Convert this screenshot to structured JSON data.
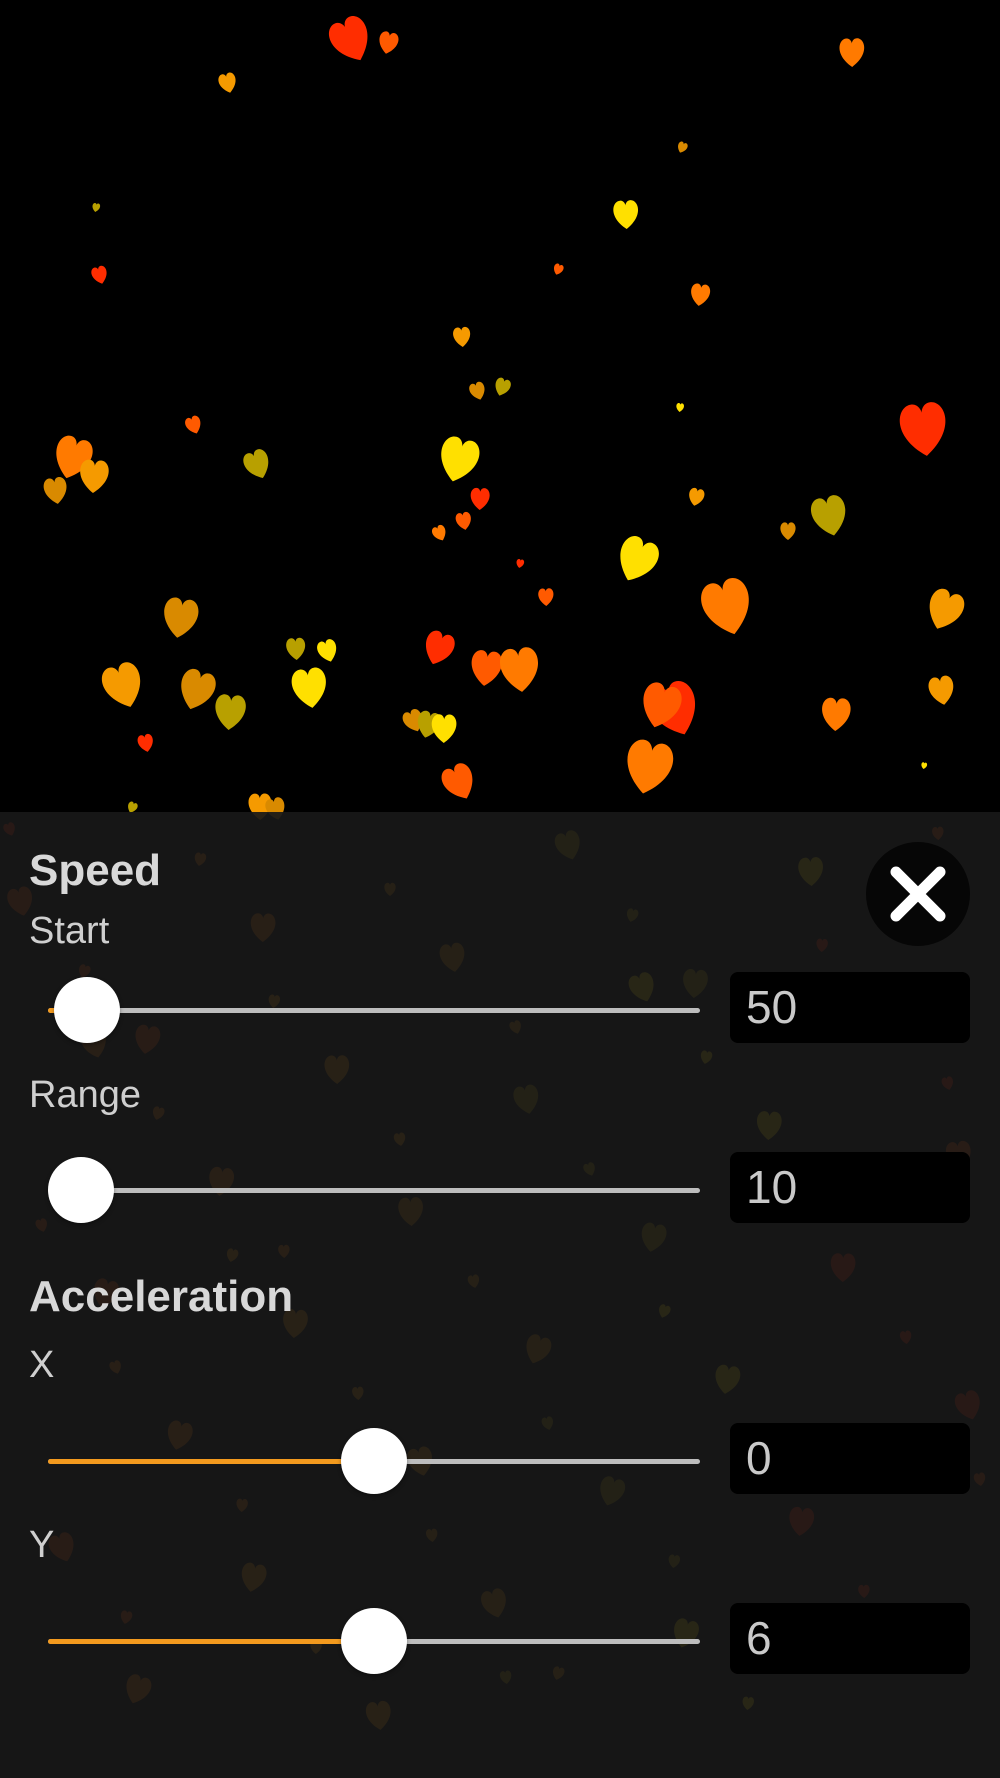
{
  "colors": {
    "accent": "#f39a1e",
    "panel_background": "#181818",
    "heart_colors": [
      "#ff2d00",
      "#ff5a00",
      "#ff7a00",
      "#f59a00",
      "#d98a00",
      "#b8a000",
      "#ffe000"
    ]
  },
  "speed": {
    "heading": "Speed",
    "start": {
      "label": "Start",
      "value": "50",
      "level": 0.06
    },
    "range": {
      "label": "Range",
      "value": "10",
      "level": 0.05
    }
  },
  "acceleration": {
    "heading": "Acceleration",
    "x": {
      "label": "X",
      "value": "0",
      "level": 0.5
    },
    "y": {
      "label": "Y",
      "value": "6",
      "level": 0.5
    }
  },
  "close": {
    "icon": "close-icon"
  }
}
